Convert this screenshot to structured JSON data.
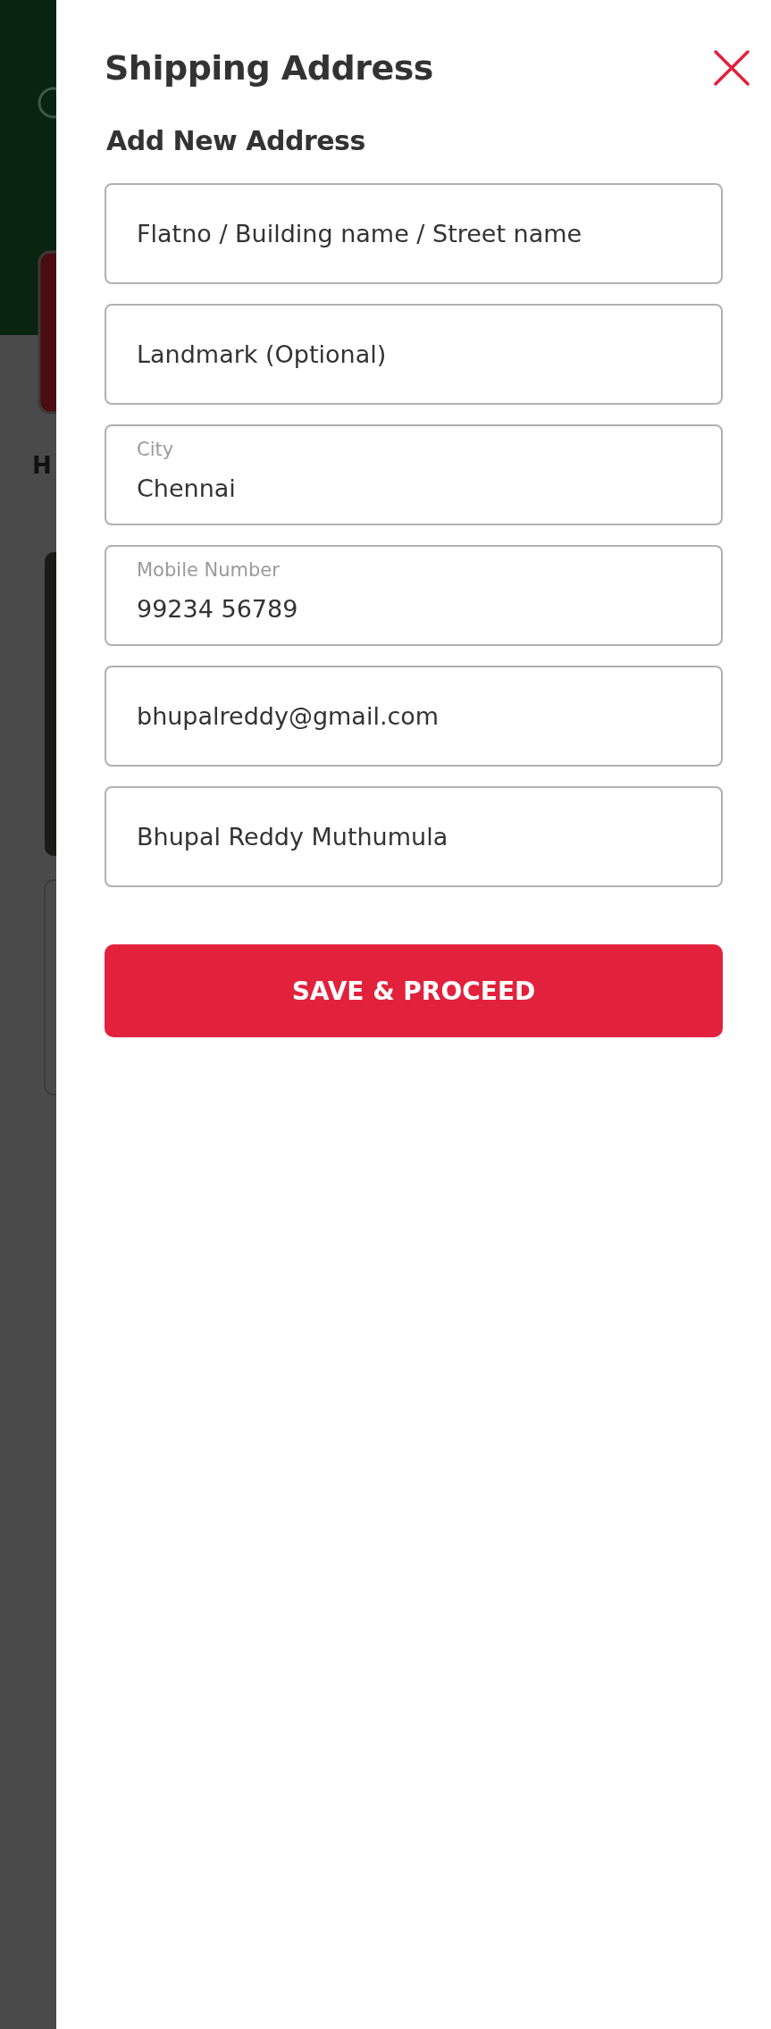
{
  "backdrop": {
    "text": "H"
  },
  "panel": {
    "title": "Shipping Address",
    "subtitle": "Add New Address"
  },
  "fields": [
    {
      "placeholder": "Flatno / Building name / Street name"
    },
    {
      "placeholder": "Landmark (Optional)"
    },
    {
      "label": "City",
      "value": "Chennai"
    },
    {
      "label": "Mobile Number",
      "value": "99234 56789"
    },
    {
      "value": "bhupalreddy@gmail.com"
    },
    {
      "value": "Bhupal Reddy Muthumula"
    }
  ],
  "button": "SAVE & PROCEED"
}
